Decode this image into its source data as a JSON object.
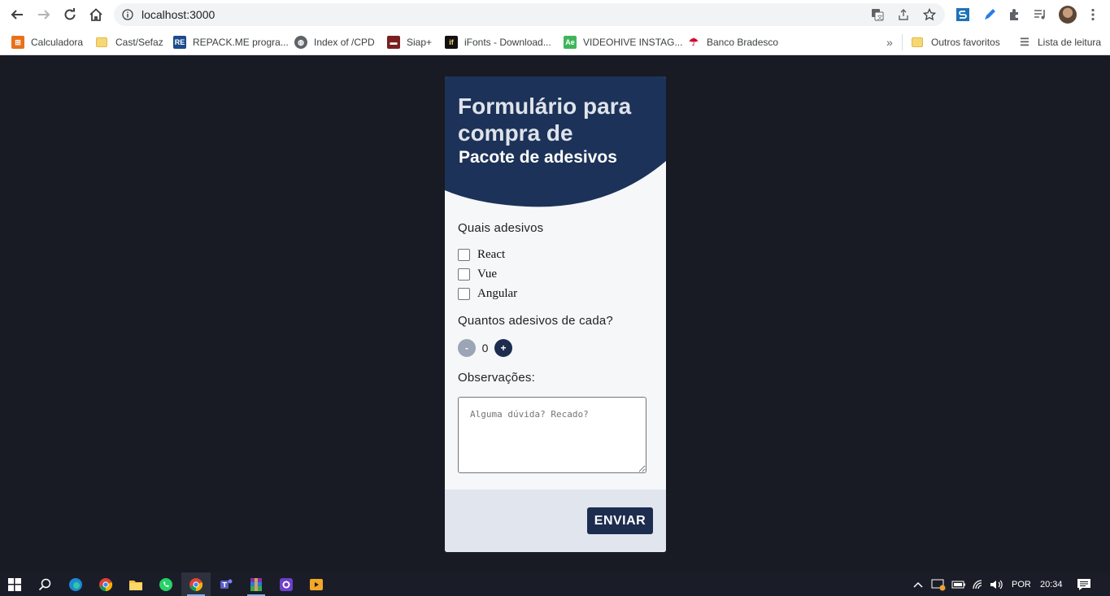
{
  "browser": {
    "url": "localhost:3000",
    "bookmarks": [
      {
        "label": "Calculadora",
        "icon": "calculator-icon",
        "color": "#e8711a"
      },
      {
        "label": "Cast/Sefaz",
        "icon": "folder-icon",
        "color": "#f7d774"
      },
      {
        "label": "REPACK.ME progra...",
        "icon": "repack-icon",
        "color": "#1c4b8c"
      },
      {
        "label": "Index of /CPD",
        "icon": "globe-icon",
        "color": "#5f6368"
      },
      {
        "label": "Siap+",
        "icon": "siap-icon",
        "color": "#7a1f1f"
      },
      {
        "label": "iFonts - Download...",
        "icon": "ifonts-icon",
        "color": "#111111"
      },
      {
        "label": "VIDEOHIVE INSTAG...",
        "icon": "videohive-icon",
        "color": "#3fb55a"
      },
      {
        "label": "Banco Bradesco",
        "icon": "bradesco-icon",
        "color": "#cc092f"
      }
    ],
    "other_favorites": "Outros favoritos",
    "reading_list": "Lista de leitura"
  },
  "form": {
    "title": "Formulário para compra de",
    "subtitle": "Pacote de adesivos",
    "stickers_label": "Quais adesivos",
    "options": [
      "React",
      "Vue",
      "Angular"
    ],
    "quantity_label": "Quantos adesivos de cada?",
    "minus_label": "-",
    "quantity_value": "0",
    "plus_label": "+",
    "notes_label": "Observações:",
    "notes_placeholder": "Alguma dúvida? Recado?",
    "submit_label": "ENVIAR",
    "colors": {
      "primary": "#1c2d4f",
      "background": "#181a24",
      "card": "#f6f7f9",
      "footer": "#e1e6ee"
    }
  },
  "taskbar": {
    "language": "POR",
    "clock": "20:34"
  }
}
